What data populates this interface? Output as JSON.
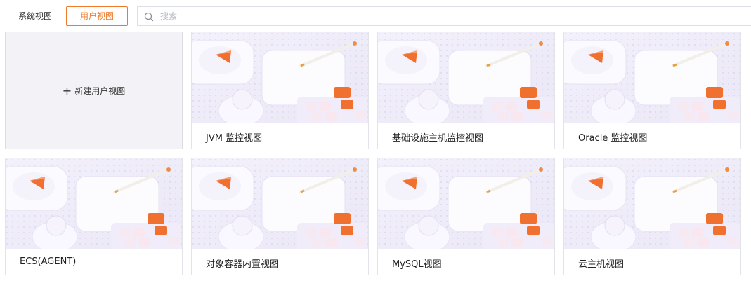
{
  "tabs": [
    {
      "label": "系统视图",
      "active": false
    },
    {
      "label": "用户视图",
      "active": true
    }
  ],
  "search": {
    "placeholder": "搜索",
    "value": ""
  },
  "new_view": {
    "label": "新建用户视图"
  },
  "views": [
    {
      "name": "JVM 监控视图"
    },
    {
      "name": "基础设施主机监控视图"
    },
    {
      "name": "Oracle 监控视图"
    },
    {
      "name": "ECS(AGENT)"
    },
    {
      "name": "对象容器内置视图"
    },
    {
      "name": "MySQL视图"
    },
    {
      "name": "云主机视图"
    }
  ],
  "colors": {
    "accent": "#f07a2a",
    "card_border": "#e2e4ea",
    "new_card_bg": "#f3f3f7"
  }
}
